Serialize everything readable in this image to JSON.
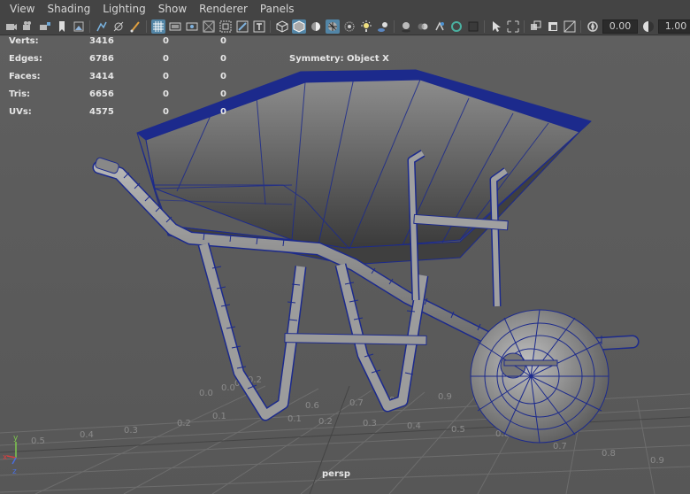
{
  "menu": [
    "View",
    "Shading",
    "Lighting",
    "Show",
    "Renderer",
    "Panels"
  ],
  "toolbar": {
    "icons_left": [
      "camera-select-icon",
      "camera-attributes-icon",
      "bookmark-icon",
      "image-plane-icon"
    ],
    "icons_mid": [
      "grid-icon",
      "film-gate-icon",
      "resolution-gate-icon",
      "gate-mask-icon",
      "field-chart-icon",
      "safe-action-icon",
      "safe-title-icon"
    ],
    "icons_shade": [
      "wireframe-icon",
      "smooth-shade-icon",
      "use-default-material-icon",
      "wireframe-on-shaded-icon",
      "xray-icon",
      "all-lights-icon",
      "shadows-icon",
      "ambient-occlusion-icon",
      "motion-blur-icon",
      "antialiasing-icon",
      "depth-of-field-icon",
      "isolate-select-icon",
      "xray-joints-icon"
    ],
    "icons_right": [
      "camera-frame-icon",
      "overscan-icon",
      "pan-zoom-icon",
      "exposure-icon",
      "gamma-icon",
      "color-management-icon"
    ],
    "exposure_value": "0.00",
    "gamma_value": "1.00"
  },
  "hud": {
    "rows": [
      {
        "label": "Verts:",
        "v1": "3416",
        "v2": "0",
        "v3": "0"
      },
      {
        "label": "Edges:",
        "v1": "6786",
        "v2": "0",
        "v3": "0"
      },
      {
        "label": "Faces:",
        "v1": "3414",
        "v2": "0",
        "v3": "0"
      },
      {
        "label": "Tris:",
        "v1": "6656",
        "v2": "0",
        "v3": "0"
      },
      {
        "label": "UVs:",
        "v1": "4575",
        "v2": "0",
        "v3": "0"
      }
    ]
  },
  "symmetry_label": "Symmetry: Object X",
  "camera_label": "persp",
  "grid_labels": [
    "0.9",
    "0.8",
    "0.7",
    "0.6",
    "0.5",
    "0.4",
    "0.3",
    "0.2",
    "0.1",
    "0.0",
    "0.1",
    "0.2",
    "0.3",
    "0.4",
    "0.5",
    "0.6",
    "0.7",
    "0.8",
    "0.9",
    "0.0",
    "0.1",
    "0.2"
  ],
  "axis_labels": {
    "x": "x",
    "y": "y",
    "z": "z"
  },
  "colors": {
    "menubar": "#444444",
    "viewport": "#5d5d5d",
    "wire": "#1c2a8c",
    "active_icon": "#5285a6"
  }
}
